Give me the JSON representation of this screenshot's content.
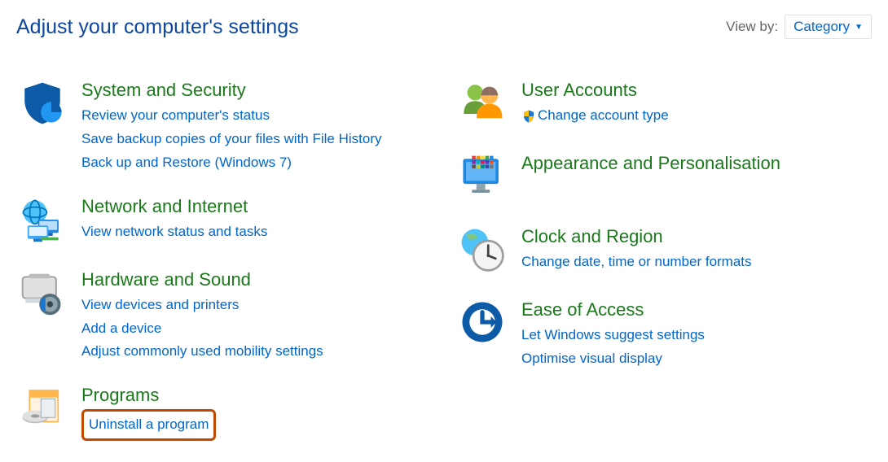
{
  "header": {
    "title": "Adjust your computer's settings",
    "view_by_label": "View by:",
    "view_by_value": "Category"
  },
  "left": [
    {
      "id": "system-security",
      "title": "System and Security",
      "links": [
        "Review your computer's status",
        "Save backup copies of your files with File History",
        "Back up and Restore (Windows 7)"
      ]
    },
    {
      "id": "network-internet",
      "title": "Network and Internet",
      "links": [
        "View network status and tasks"
      ]
    },
    {
      "id": "hardware-sound",
      "title": "Hardware and Sound",
      "links": [
        "View devices and printers",
        "Add a device",
        "Adjust commonly used mobility settings"
      ]
    },
    {
      "id": "programs",
      "title": "Programs",
      "links": [
        "Uninstall a program"
      ],
      "highlight_first": true
    }
  ],
  "right": [
    {
      "id": "user-accounts",
      "title": "User Accounts",
      "links": [
        "Change account type"
      ],
      "shield_first": true
    },
    {
      "id": "appearance",
      "title": "Appearance and Personalisation",
      "links": []
    },
    {
      "id": "clock-region",
      "title": "Clock and Region",
      "links": [
        "Change date, time or number formats"
      ]
    },
    {
      "id": "ease-of-access",
      "title": "Ease of Access",
      "links": [
        "Let Windows suggest settings",
        "Optimise visual display"
      ]
    }
  ]
}
